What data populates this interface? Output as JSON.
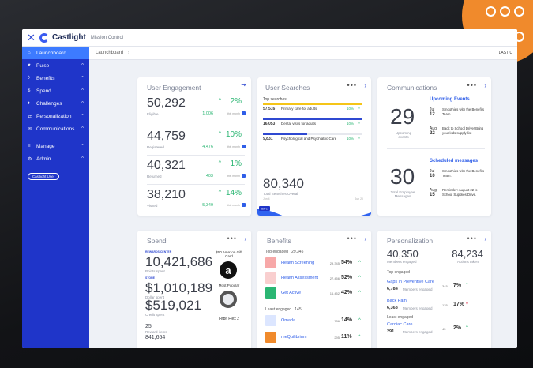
{
  "app": {
    "close": "✕",
    "brand": "Castlight",
    "section": "Mission Control"
  },
  "sidebar": {
    "items": [
      {
        "label": "Launchboard",
        "icon": "⌂"
      },
      {
        "label": "Pulse",
        "icon": "♥"
      },
      {
        "label": "Benefits",
        "icon": "◊"
      },
      {
        "label": "Spend",
        "icon": "$"
      },
      {
        "label": "Challenges",
        "icon": "♦"
      },
      {
        "label": "Personalization",
        "icon": "⇄"
      },
      {
        "label": "Communications",
        "icon": "✉"
      },
      {
        "label": "Manage",
        "icon": "≡"
      },
      {
        "label": "Admin",
        "icon": "⚙"
      }
    ],
    "badge": "Castlight User"
  },
  "breadcrumb": {
    "label": "Launchboard",
    "last": "LAST U"
  },
  "engagement": {
    "title": "User Engagement",
    "rows": [
      {
        "value": "50,292",
        "label": "Eligible",
        "pct": "2%",
        "delta": "1,006",
        "period": "this month"
      },
      {
        "value": "44,759",
        "label": "Registered",
        "pct": "10%",
        "delta": "4,476",
        "period": "this month"
      },
      {
        "value": "40,321",
        "label": "Returned",
        "pct": "1%",
        "delta": "403",
        "period": "this month"
      },
      {
        "value": "38,210",
        "label": "Visited",
        "pct": "14%",
        "delta": "5,349",
        "period": "this month"
      }
    ]
  },
  "searches": {
    "title": "User Searches",
    "top": "Top searches",
    "items": [
      {
        "count": "57,516",
        "label": "Primary care for adults",
        "pct": "10%",
        "fill": 1.0,
        "color": "#f5c518"
      },
      {
        "count": "16,053",
        "label": "Dental visits for adults",
        "pct": "10%",
        "fill": 1.0,
        "color": "#2f49d1"
      },
      {
        "count": "9,831",
        "label": "Psychological and Psychiatric Care",
        "pct": "10%",
        "fill": 0.45,
        "color": "#2f49d1"
      }
    ],
    "total": "80,340",
    "total_label": "Total Searches Overall",
    "start": "Jun 4",
    "end": "Jun 20",
    "tags": [
      "8971",
      "5245",
      "5430"
    ]
  },
  "comms": {
    "title": "Communications",
    "upcoming_title": "Upcoming Events",
    "upcoming_num": "29",
    "upcoming_label": "Upcoming events",
    "events": [
      {
        "mon": "Jul",
        "day": "12",
        "text": "Smoothies with the Benefits Team"
      },
      {
        "mon": "Aug",
        "day": "22",
        "text": "Back to School Drive! Bring your kids supply list"
      }
    ],
    "scheduled_title": "Scheduled messages",
    "scheduled_num": "30",
    "scheduled_label": "Total Employee Messages",
    "messages": [
      {
        "mon": "Jul",
        "day": "10",
        "text": "Smoothies with the Benefits Team."
      },
      {
        "mon": "Aug",
        "day": "15",
        "text": "Reminder: August 22 is School Supplies Drive."
      }
    ]
  },
  "spend": {
    "title": "Spend",
    "rewards_label": "REWARDS CENTER",
    "points": "10,421,686",
    "points_label": "Points spent",
    "store_label": "STORE",
    "dollars": "$1,010,189",
    "dollars_label": "Dollar spent",
    "credit": "$519,021",
    "credit_label": "Credit spent",
    "reward_items": "25",
    "reward_items_label": "Reward items",
    "redeemed": "841,654",
    "gift": "$50 Amazon Gift Card",
    "popular": "Most Popular",
    "fitbit": "Fitbit Flex 2"
  },
  "benefits": {
    "title": "Benefits",
    "top_label": "Top engaged",
    "top_count": "29,345",
    "items": [
      {
        "name": "Health Screening",
        "count": "29,345",
        "pct": "54%",
        "dir": "up",
        "color": "#f7a8a8"
      },
      {
        "name": "Health Assessment",
        "count": "27,456",
        "pct": "52%",
        "dir": "up",
        "color": "#f9cfcf"
      },
      {
        "name": "Get Active",
        "count": "16,452",
        "pct": "42%",
        "dir": "up",
        "color": "#2bb673"
      }
    ],
    "least_label": "Least engaged",
    "least_count": "145",
    "least": [
      {
        "name": "Omada",
        "count": "736",
        "pct": "14%",
        "dir": "up",
        "color": "#dce6ff"
      },
      {
        "name": "meQuilibrium",
        "count": "295",
        "pct": "11%",
        "dir": "up",
        "color": "#f08a2c"
      }
    ]
  },
  "personalization": {
    "title": "Personalization",
    "members": "40,350",
    "members_label": "Members engaged",
    "actions": "84,234",
    "actions_label": "Actions taken",
    "top_label": "Top engaged",
    "top": [
      {
        "name": "Gaps in Preventive Care",
        "count": "6,784",
        "label": "Members engaged",
        "num": "345",
        "pct": "7%",
        "dir": "up"
      },
      {
        "name": "Back Pain",
        "count": "6,363",
        "label": "Members engaged",
        "num": "135",
        "pct": "17%",
        "dir": "down"
      }
    ],
    "least_label": "Least engaged",
    "least": [
      {
        "name": "Cardiac Care",
        "count": "291",
        "label": "Members engaged",
        "num": "45",
        "pct": "2%",
        "dir": "up"
      }
    ]
  }
}
